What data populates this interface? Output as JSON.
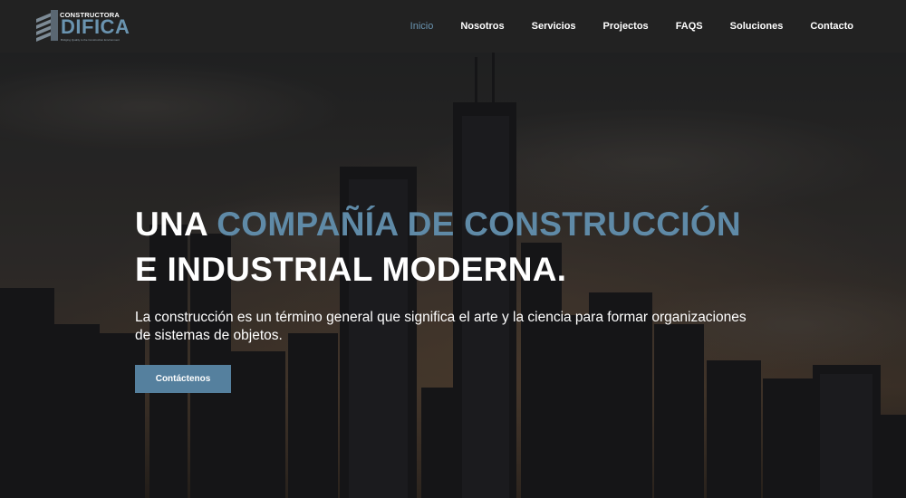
{
  "brand": {
    "top_text": "CONSTRUCTORA",
    "main_text": "DIFICA",
    "tagline": "Bridging Quality to the Construction Environment",
    "accent_color": "#6a94b0"
  },
  "nav": {
    "items": [
      {
        "label": "Inicio",
        "active": true
      },
      {
        "label": "Nosotros",
        "active": false
      },
      {
        "label": "Servicios",
        "active": false
      },
      {
        "label": "Projectos",
        "active": false
      },
      {
        "label": "FAQS",
        "active": false
      },
      {
        "label": "Soluciones",
        "active": false
      },
      {
        "label": "Contacto",
        "active": false
      }
    ]
  },
  "hero": {
    "headline_part1": "UNA ",
    "headline_accent": "COMPAÑÍA DE CONSTRUCCIÓN",
    "headline_part2": "E INDUSTRIAL MODERNA.",
    "lead": "La construcción es un término general que significa el arte y la ciencia para formar organizaciones de sistemas de objetos.",
    "cta_label": "Contáctenos",
    "cta_color": "#55809e",
    "accent_color": "#5f8aa7"
  }
}
